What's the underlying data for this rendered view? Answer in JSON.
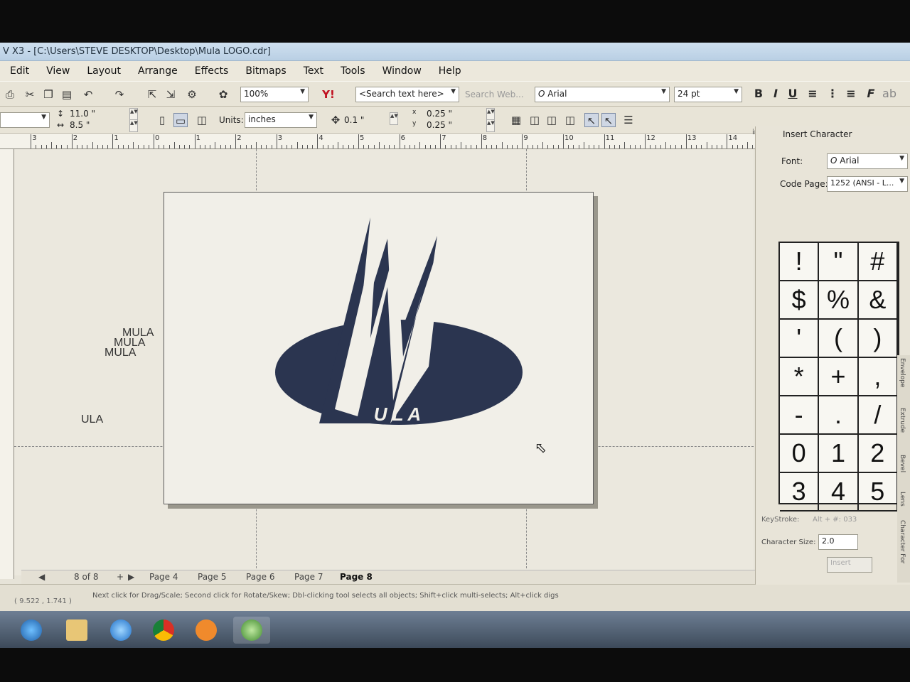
{
  "window": {
    "title": "V X3 - [C:\\Users\\STEVE DESKTOP\\Desktop\\Mula LOGO.cdr]"
  },
  "menu": [
    "Edit",
    "View",
    "Layout",
    "Arrange",
    "Effects",
    "Bitmaps",
    "Text",
    "Tools",
    "Window",
    "Help"
  ],
  "toolbar": {
    "zoom": "100%",
    "search_placeholder": "<Search text here>",
    "search_web": "Search Web...",
    "font": "Arial",
    "font_icon": "O",
    "font_size": "24 pt"
  },
  "propbar": {
    "width": "11.0 \"",
    "height": "8.5 \"",
    "units_label": "Units:",
    "units_value": "inches",
    "nudge": "0.1 \"",
    "dup_x": "0.25 \"",
    "dup_y": "0.25 \"",
    "x_label": "x",
    "y_label": "y"
  },
  "ruler": {
    "units": "inches",
    "labels": [
      "3",
      "2",
      "1",
      "0",
      "1",
      "2",
      "3",
      "4",
      "5",
      "6",
      "7",
      "8",
      "9",
      "10",
      "11",
      "12",
      "13",
      "14"
    ]
  },
  "canvas": {
    "stray_text": [
      "MULA",
      "MULA",
      "MULA",
      "ULA"
    ],
    "logo_sub": "U L A"
  },
  "page_nav": {
    "count": "8 of 8",
    "tabs": [
      "Page 4",
      "Page 5",
      "Page 6",
      "Page 7",
      "Page 8"
    ],
    "active": "Page 8"
  },
  "status": {
    "coords": "( 9.522 , 1.741 )",
    "hint": "Next click for Drag/Scale; Second click for Rotate/Skew; Dbl-clicking tool selects all objects; Shift+click multi-selects; Alt+click digs"
  },
  "docker": {
    "title": "Insert Character",
    "font_label": "Font:",
    "font_value": "Arial",
    "codepage_label": "Code Page:",
    "codepage_value": "1252 (ANSI - L...",
    "characters": [
      "!",
      "\"",
      "#",
      "$",
      "%",
      "&",
      "'",
      "(",
      ")",
      "*",
      "+",
      ",",
      "-",
      ".",
      "/",
      "0",
      "1",
      "2",
      "3",
      "4",
      "5"
    ],
    "keystroke_label": "KeyStroke:",
    "keystroke_value": "Alt + #: 033",
    "size_label": "Character Size:",
    "size_value": "2.0",
    "insert_label": "Insert",
    "side_tabs": [
      "Envelope",
      "Extrude",
      "Bevel",
      "Lens",
      "Character For"
    ]
  },
  "colors": {
    "logo": "#2b3550",
    "titlebar": "#c3d6e9",
    "app_bg": "#e8e4d7"
  }
}
